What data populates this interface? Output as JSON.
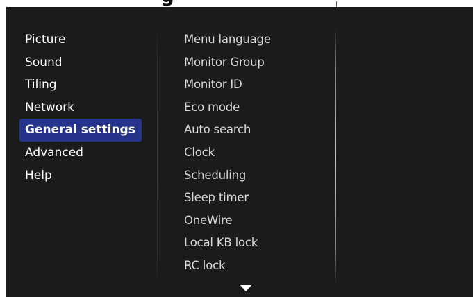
{
  "window": {
    "title_fragment": "g"
  },
  "categories": [
    {
      "label": "Picture",
      "selected": false
    },
    {
      "label": "Sound",
      "selected": false
    },
    {
      "label": "Tiling",
      "selected": false
    },
    {
      "label": "Network",
      "selected": false
    },
    {
      "label": "General settings",
      "selected": true
    },
    {
      "label": "Advanced",
      "selected": false
    },
    {
      "label": "Help",
      "selected": false
    }
  ],
  "options": [
    {
      "label": "Menu language"
    },
    {
      "label": "Monitor Group"
    },
    {
      "label": "Monitor ID"
    },
    {
      "label": "Eco mode"
    },
    {
      "label": "Auto search"
    },
    {
      "label": "Clock"
    },
    {
      "label": "Scheduling"
    },
    {
      "label": "Sleep timer"
    },
    {
      "label": "OneWire"
    },
    {
      "label": "Local KB lock"
    },
    {
      "label": "RC lock"
    }
  ],
  "icons": {
    "scroll_down": "triangle-down-icon"
  },
  "colors": {
    "background": "#1b1b1b",
    "selected_highlight": "#25338a",
    "category_text": "#ffffff",
    "option_text": "#d8d8d8"
  }
}
